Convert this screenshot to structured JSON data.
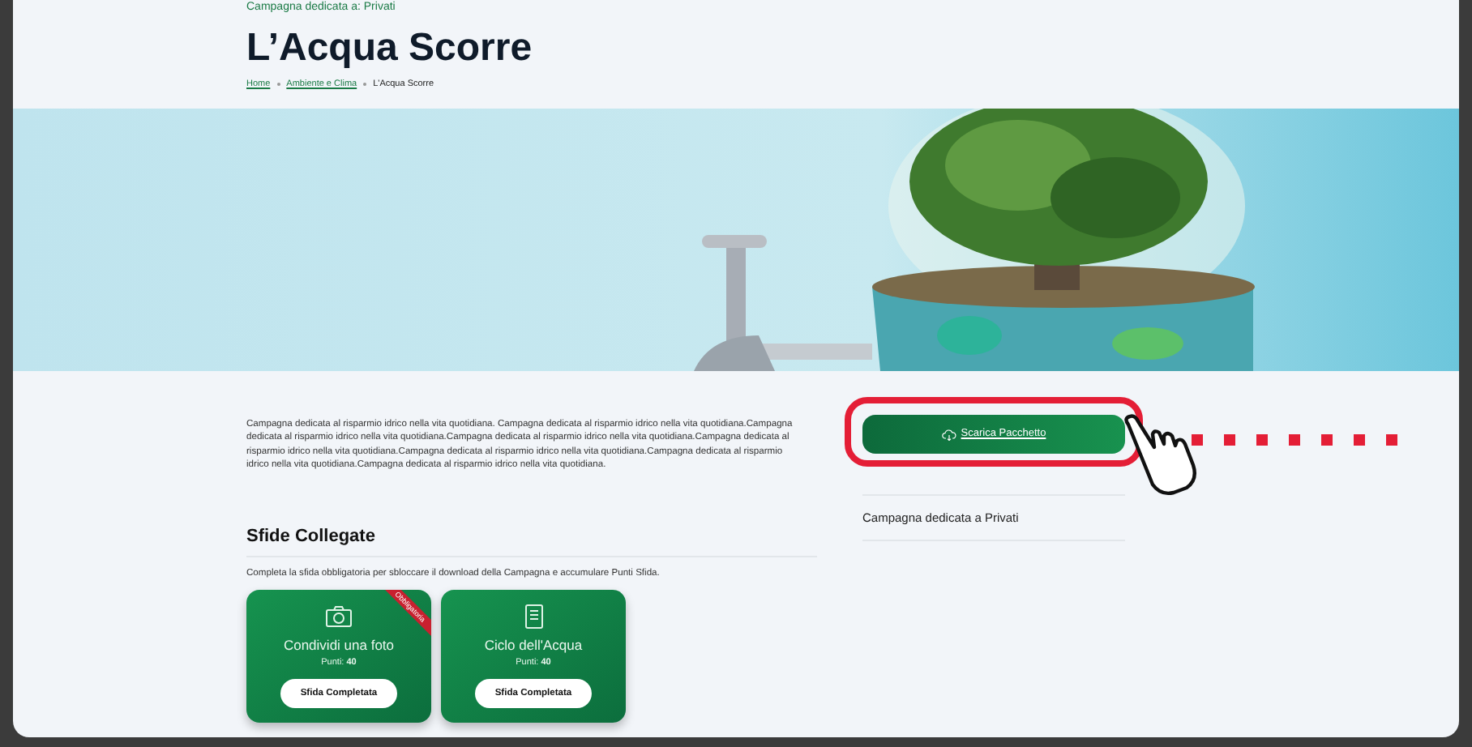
{
  "header": {
    "eyebrow": "Campagna dedicata a: Privati",
    "title": "L’Acqua Scorre",
    "breadcrumb": [
      {
        "label": "Home",
        "link": true
      },
      {
        "label": "Ambiente e Clima",
        "link": true
      },
      {
        "label": "L'Acqua Scorre",
        "link": false
      }
    ]
  },
  "description": "Campagna dedicata al risparmio idrico nella vita quotidiana. Campagna dedicata al risparmio idrico nella vita quotidiana.Campagna dedicata al risparmio idrico nella vita quotidiana.Campagna dedicata al risparmio idrico nella vita quotidiana.Campagna dedicata al risparmio idrico nella vita quotidiana.Campagna dedicata al risparmio idrico nella vita quotidiana.Campagna dedicata al risparmio idrico nella vita quotidiana.Campagna dedicata al risparmio idrico nella vita quotidiana.",
  "challenges": {
    "title": "Sfide Collegate",
    "subtitle": "Completa la sfida obbligatoria per sbloccare il download della Campagna e accumulare Punti Sfida.",
    "cards": [
      {
        "kind": "camera",
        "title": "Condividi una foto",
        "points": "Punti: **40**",
        "button": "Sfida Completata",
        "ribbon": "Obbligatoria"
      },
      {
        "kind": "document",
        "title": "Ciclo dell'Acqua",
        "points": "Punti: **40**",
        "button": "Sfida Completata"
      }
    ]
  },
  "sidebar": {
    "download_button": "Scarica Pacchetto",
    "audience": "Campagna dedicata a Privati"
  }
}
